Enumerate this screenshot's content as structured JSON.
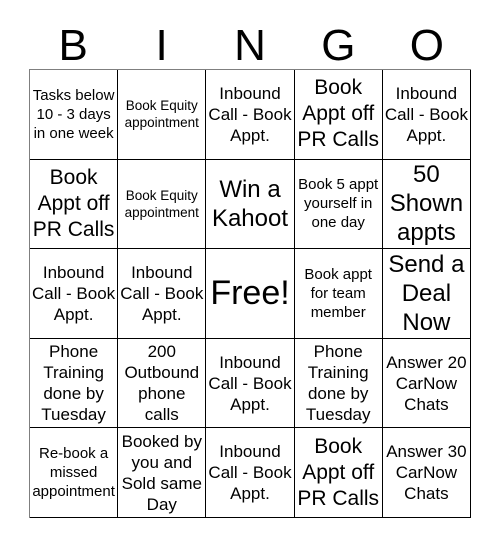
{
  "header": {
    "letters": [
      "B",
      "I",
      "N",
      "G",
      "O"
    ]
  },
  "grid": {
    "rows": 5,
    "columns": 5,
    "cells": [
      {
        "text": "Tasks below 10 - 3 days in one week",
        "size": "sm"
      },
      {
        "text": "Book Equity appointment",
        "size": "xs"
      },
      {
        "text": "Inbound Call - Book Appt.",
        "size": "md"
      },
      {
        "text": "Book Appt off PR Calls",
        "size": "lg"
      },
      {
        "text": "Inbound Call - Book Appt.",
        "size": "md"
      },
      {
        "text": "Book Appt off PR Calls",
        "size": "lg"
      },
      {
        "text": "Book Equity appointment",
        "size": "xs"
      },
      {
        "text": "Win a Kahoot",
        "size": "xl"
      },
      {
        "text": "Book 5 appt yourself in one day",
        "size": "sm"
      },
      {
        "text": "50 Shown appts",
        "size": "xl"
      },
      {
        "text": "Inbound Call - Book Appt.",
        "size": "md"
      },
      {
        "text": "Inbound Call - Book Appt.",
        "size": "md"
      },
      {
        "text": "Free!",
        "size": "xxl"
      },
      {
        "text": "Book appt for team member",
        "size": "sm"
      },
      {
        "text": "Send a Deal Now",
        "size": "xl"
      },
      {
        "text": "Phone Training done by Tuesday",
        "size": "md"
      },
      {
        "text": "200 Outbound phone calls",
        "size": "md"
      },
      {
        "text": "Inbound Call - Book Appt.",
        "size": "md"
      },
      {
        "text": "Phone Training done by Tuesday",
        "size": "md"
      },
      {
        "text": "Answer 20 CarNow Chats",
        "size": "md"
      },
      {
        "text": "Re-book a missed appointment",
        "size": "sm"
      },
      {
        "text": "Booked by you and Sold same Day",
        "size": "md"
      },
      {
        "text": "Inbound Call - Book Appt.",
        "size": "md"
      },
      {
        "text": "Book Appt off PR Calls",
        "size": "lg"
      },
      {
        "text": "Answer 30 CarNow Chats",
        "size": "md"
      }
    ]
  },
  "colors": {
    "background": "#ffffff",
    "text": "#000000",
    "grid_line": "#000000"
  }
}
